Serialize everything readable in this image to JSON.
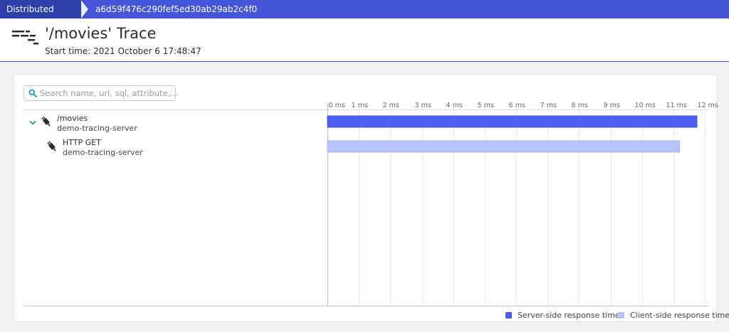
{
  "breadcrumb": {
    "items": [
      "Distributed traces",
      "a6d59f476c290fef5ed30ab29ab2c4f0"
    ]
  },
  "header": {
    "icon": "trace-waterfall-icon",
    "title": "'/movies' Trace",
    "start_time": "Start time: 2021 October 6 17:48:47"
  },
  "search": {
    "placeholder": "Search name, url, sql, attribute,..."
  },
  "rows": [
    {
      "name": "/movies",
      "service": "demo-tracing-server",
      "icon": "service-plug-icon",
      "expanded": true
    },
    {
      "name": "HTTP GET",
      "service": "demo-tracing-server",
      "icon": "service-plug-icon",
      "expanded": false
    }
  ],
  "legend": {
    "server": "Server-side response time",
    "client": "Client-side response time"
  },
  "colors": {
    "brand": "#4556d9",
    "breadcrumb_active": "#2d3fa8",
    "server_bar": "#4c5ff0",
    "client_bar": "#b8c3fa",
    "accent_teal": "#00a1b2"
  },
  "chart_data": {
    "type": "bar",
    "xlabel": "",
    "ylabel": "",
    "xlim": [
      0,
      12
    ],
    "x_ticks": [
      "0 ms",
      "1 ms",
      "2 ms",
      "3 ms",
      "4 ms",
      "5 ms",
      "6 ms",
      "7 ms",
      "8 ms",
      "9 ms",
      "10 ms",
      "11 ms",
      "12 ms"
    ],
    "grid": true,
    "legend_position": "bottom-right",
    "series": [
      {
        "name": "Server-side response time",
        "category": "/movies",
        "start": 0,
        "duration": 11.75
      },
      {
        "name": "Client-side response time",
        "category": "HTTP GET",
        "start": 0,
        "duration": 11.2
      }
    ]
  }
}
